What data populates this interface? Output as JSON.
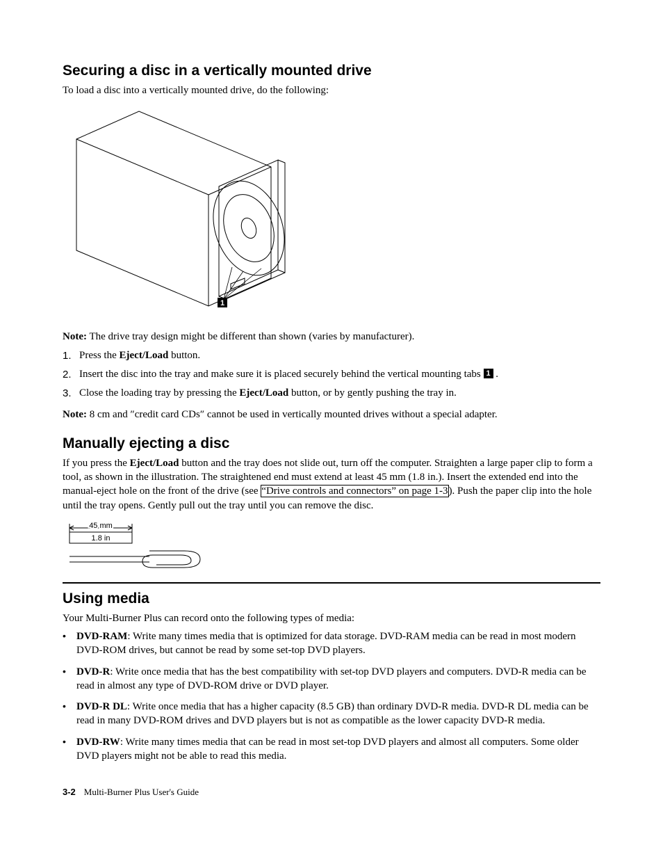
{
  "section1": {
    "heading": "Securing a disc in a vertically mounted drive",
    "intro": "To load a disc into a vertically mounted drive, do the following:",
    "note_prefix": "Note:",
    "note1": " The drive tray design might be different than shown (varies by manufacturer).",
    "steps_prefix": [
      "1.",
      "2.",
      "3."
    ],
    "step1_a": "Press the ",
    "step1_b": "Eject/Load",
    "step1_c": " button.",
    "step2_a": "Insert the disc into the tray and make sure it is placed securely behind the vertical mounting tabs ",
    "step2_b": " .",
    "step3_a": "Close the loading tray by pressing the ",
    "step3_b": "Eject/Load",
    "step3_c": " button, or by gently pushing the tray in.",
    "note2": " 8 cm and ″credit card CDs″ cannot be used in vertically mounted drives without a special adapter.",
    "callout_label": "1"
  },
  "section2": {
    "heading": "Manually ejecting a disc",
    "p1_a": "If you press the ",
    "p1_b": "Eject/Load",
    "p1_c": " button and the tray does not slide out, turn off the computer. Straighten a large paper clip to form a tool, as shown in the illustration. The straightened end must extend at least 45 mm (1.8 in.). Insert the extended end into the manual-eject hole on the front of the drive (see ",
    "p1_link": "“Drive controls and connectors” on page 1-3",
    "p1_d": "). Push the paper clip into the hole until the tray opens. Gently pull out the tray until you can remove the disc.",
    "dim_mm": "45 mm",
    "dim_in": "1.8 in"
  },
  "section3": {
    "heading": "Using media",
    "intro": "Your Multi-Burner Plus can record onto the following types of media:",
    "items": [
      {
        "term": "DVD-RAM",
        "def": ": Write many times media that is optimized for data storage. DVD-RAM media can be read in most modern DVD-ROM drives, but cannot be read by some set-top DVD players."
      },
      {
        "term": "DVD-R",
        "def": ": Write once media that has the best compatibility with set-top DVD players and computers. DVD-R media can be read in almost any type of DVD-ROM drive or DVD player."
      },
      {
        "term": "DVD-R DL",
        "def": ": Write once media that has a higher capacity (8.5 GB) than ordinary DVD-R media. DVD-R DL media can be read in many DVD-ROM drives and DVD players but is not as compatible as the lower capacity DVD-R media."
      },
      {
        "term": "DVD-RW",
        "def": ": Write many times media that can be read in most set-top DVD players and almost all computers. Some older DVD players might not be able to read this media."
      }
    ]
  },
  "footer": {
    "pageno": "3-2",
    "title": "Multi-Burner Plus User's Guide"
  }
}
